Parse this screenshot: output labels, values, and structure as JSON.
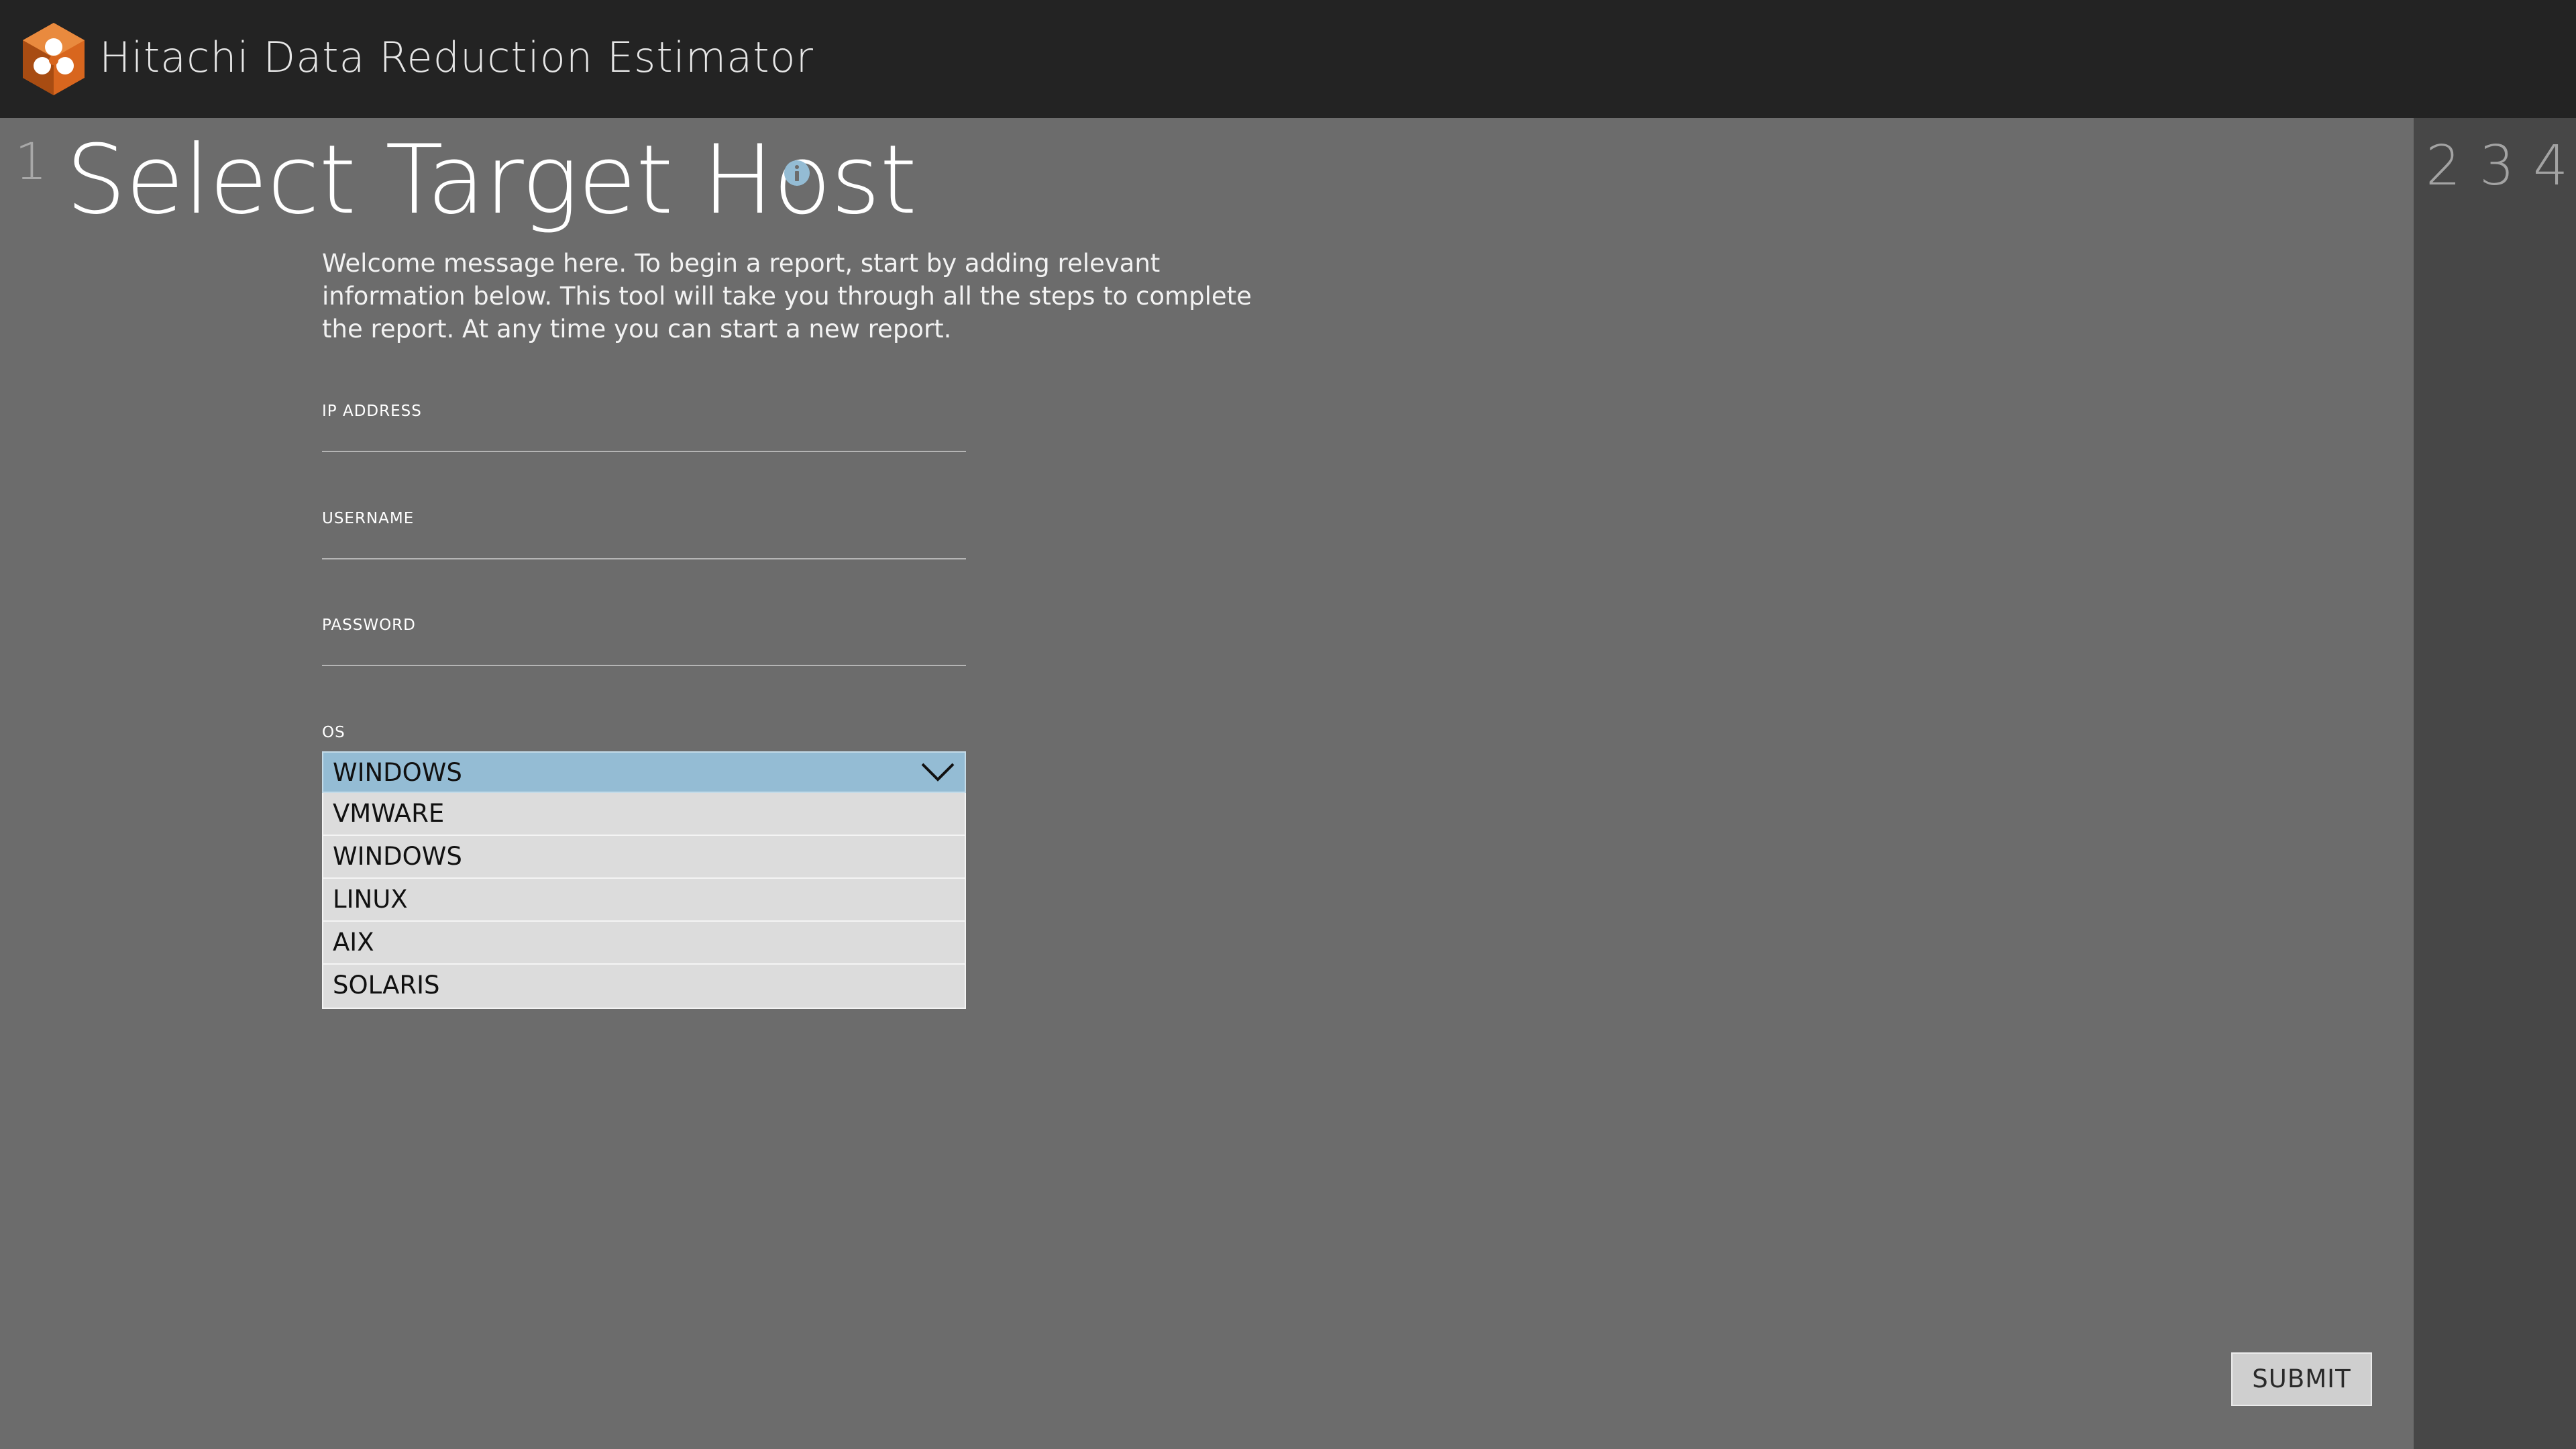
{
  "header": {
    "app_title": "Hitachi Data Reduction Estimator",
    "logo_icon": "hitachi-hexagon-logo",
    "logo_color": "#d8661e"
  },
  "steps": {
    "current": "1",
    "upcoming": [
      "2",
      "3",
      "4"
    ]
  },
  "page": {
    "title": "Select Target Host",
    "info_icon": "info-icon",
    "welcome": "Welcome message here. To begin a report, start by adding relevant information below. This tool will take you through all the steps to complete the report. At any time you can start a new report."
  },
  "form": {
    "ip_address": {
      "label": "IP ADDRESS",
      "value": ""
    },
    "username": {
      "label": "USERNAME",
      "value": ""
    },
    "password": {
      "label": "PASSWORD",
      "value": ""
    },
    "os": {
      "label": "OS",
      "selected": "WINDOWS",
      "options": [
        "VMWARE",
        "WINDOWS",
        "LINUX",
        "AIX",
        "SOLARIS"
      ],
      "dropdown_icon": "chevron-down-icon"
    },
    "submit_label": "SUBMIT"
  },
  "colors": {
    "header_bg": "#232323",
    "main_bg": "#6c6c6c",
    "rail_bg": "#474747",
    "accent": "#94bcd4",
    "option_bg": "#dcdcdc"
  }
}
